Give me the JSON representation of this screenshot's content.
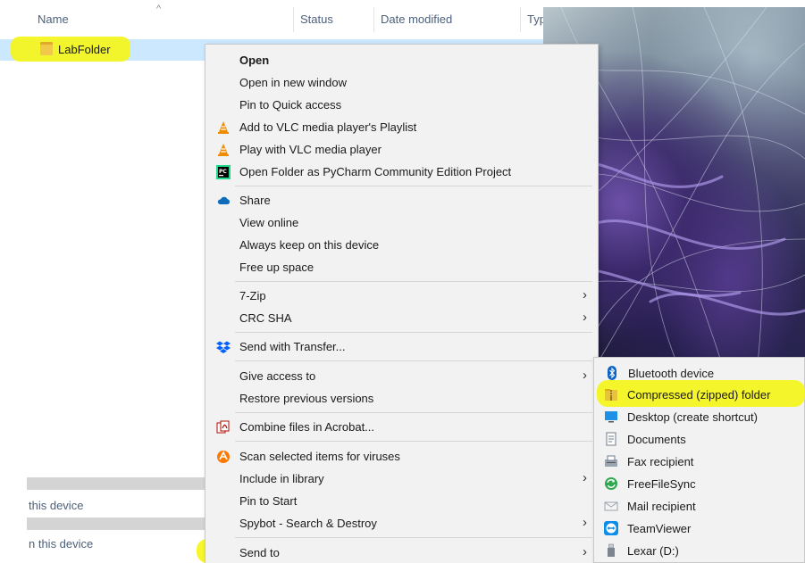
{
  "explorer": {
    "columns": {
      "name": "Name",
      "status": "Status",
      "date_modified": "Date modified",
      "type": "Typ"
    },
    "selected_item": "LabFolder",
    "nav": {
      "colon": ":",
      "item1": "this device",
      "item2": "n this device"
    }
  },
  "context_menu": {
    "items": [
      {
        "label": "Open",
        "icon": ""
      },
      {
        "label": "Open in new window",
        "icon": ""
      },
      {
        "label": "Pin to Quick access",
        "icon": ""
      },
      {
        "label": "Add to VLC media player's Playlist",
        "icon": "vlc-icon"
      },
      {
        "label": "Play with VLC media player",
        "icon": "vlc-icon"
      },
      {
        "label": "Open Folder as PyCharm Community Edition Project",
        "icon": "pycharm-icon"
      },
      {
        "label": "Share",
        "icon": "onedrive-cloud-icon"
      },
      {
        "label": "View online",
        "icon": ""
      },
      {
        "label": "Always keep on this device",
        "icon": ""
      },
      {
        "label": "Free up space",
        "icon": ""
      },
      {
        "label": "7-Zip",
        "icon": "",
        "submenu": true
      },
      {
        "label": "CRC SHA",
        "icon": "",
        "submenu": true
      },
      {
        "label": "Send with Transfer...",
        "icon": "dropbox-icon"
      },
      {
        "label": "Give access to",
        "icon": "",
        "submenu": true
      },
      {
        "label": "Restore previous versions",
        "icon": ""
      },
      {
        "label": "Combine files in Acrobat...",
        "icon": "acrobat-icon"
      },
      {
        "label": "Scan selected items for viruses",
        "icon": "avast-icon"
      },
      {
        "label": "Include in library",
        "icon": "",
        "submenu": true
      },
      {
        "label": "Pin to Start",
        "icon": ""
      },
      {
        "label": "Spybot - Search & Destroy",
        "icon": "",
        "submenu": true
      },
      {
        "label": "Send to",
        "icon": "",
        "submenu": true
      }
    ],
    "chevron": "›"
  },
  "send_to_menu": {
    "items": [
      {
        "label": "Bluetooth device",
        "icon": "bluetooth-icon"
      },
      {
        "label": "Compressed (zipped) folder",
        "icon": "zip-folder-icon"
      },
      {
        "label": "Desktop (create shortcut)",
        "icon": "desktop-icon"
      },
      {
        "label": "Documents",
        "icon": "documents-icon"
      },
      {
        "label": "Fax recipient",
        "icon": "fax-icon"
      },
      {
        "label": "FreeFileSync",
        "icon": "freefilesync-icon"
      },
      {
        "label": "Mail recipient",
        "icon": "mail-icon"
      },
      {
        "label": "TeamViewer",
        "icon": "teamviewer-icon"
      },
      {
        "label": "Lexar (D:)",
        "icon": "usb-drive-icon"
      }
    ]
  },
  "colors": {
    "highlight": "#f5f51a",
    "selection": "#cce8ff",
    "menu_bg": "#f2f2f2"
  }
}
